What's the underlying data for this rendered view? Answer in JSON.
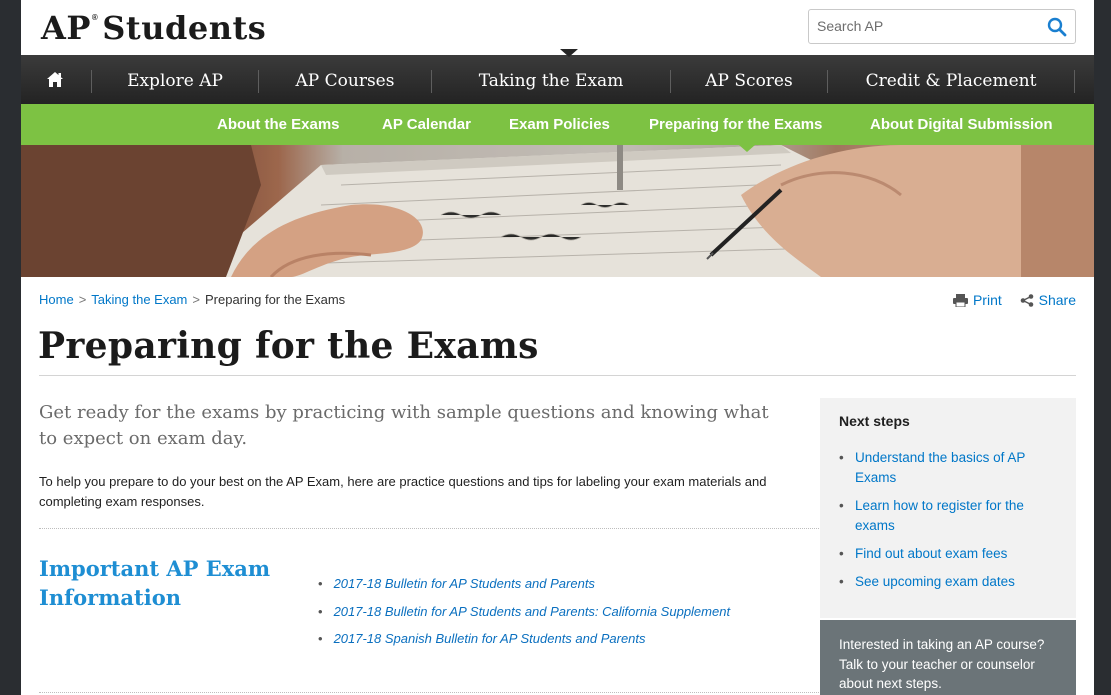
{
  "logo": {
    "text": "AP",
    "registered": "®",
    "suffix": "Students"
  },
  "search": {
    "placeholder": "Search AP"
  },
  "nav": {
    "home_icon": "home-icon",
    "items": [
      "Explore AP",
      "AP Courses",
      "Taking the Exam",
      "AP Scores",
      "Credit & Placement"
    ],
    "active": "Taking the Exam"
  },
  "subnav": {
    "items": [
      "About the Exams",
      "AP Calendar",
      "Exam Policies",
      "Preparing for the Exams",
      "About Digital Submission"
    ],
    "active": "Preparing for the Exams"
  },
  "breadcrumb": {
    "home": "Home",
    "parent": "Taking the Exam",
    "current": "Preparing for the Exams",
    "separator": ">"
  },
  "tools": {
    "print": "Print",
    "share": "Share"
  },
  "page_title": "Preparing for the Exams",
  "intro": "Get ready for the exams by practicing with sample questions and knowing what to expect on exam day.",
  "body_text": "To help you prepare to do your best on the AP Exam, here are practice questions and tips for labeling your exam materials and completing exam responses.",
  "section": {
    "heading": "Important AP Exam Information",
    "links": [
      "2017-18 Bulletin for AP Students and Parents",
      "2017-18 Bulletin for AP Students and Parents: California Supplement",
      "2017-18 Spanish Bulletin for AP Students and Parents"
    ]
  },
  "sidebar": {
    "title": "Next steps",
    "items": [
      "Understand the basics of AP Exams",
      "Learn how to register for the exams",
      "Find out about exam fees",
      "See upcoming exam dates"
    ]
  },
  "callout": "Interested in taking an AP course? Talk to your teacher or counselor about next steps.",
  "colors": {
    "nav_bg": "#2b2b2b",
    "subnav_bg": "#7dc243",
    "link": "#0077c8",
    "heading_blue": "#1e8ed3",
    "callout_bg": "#6b7478"
  }
}
